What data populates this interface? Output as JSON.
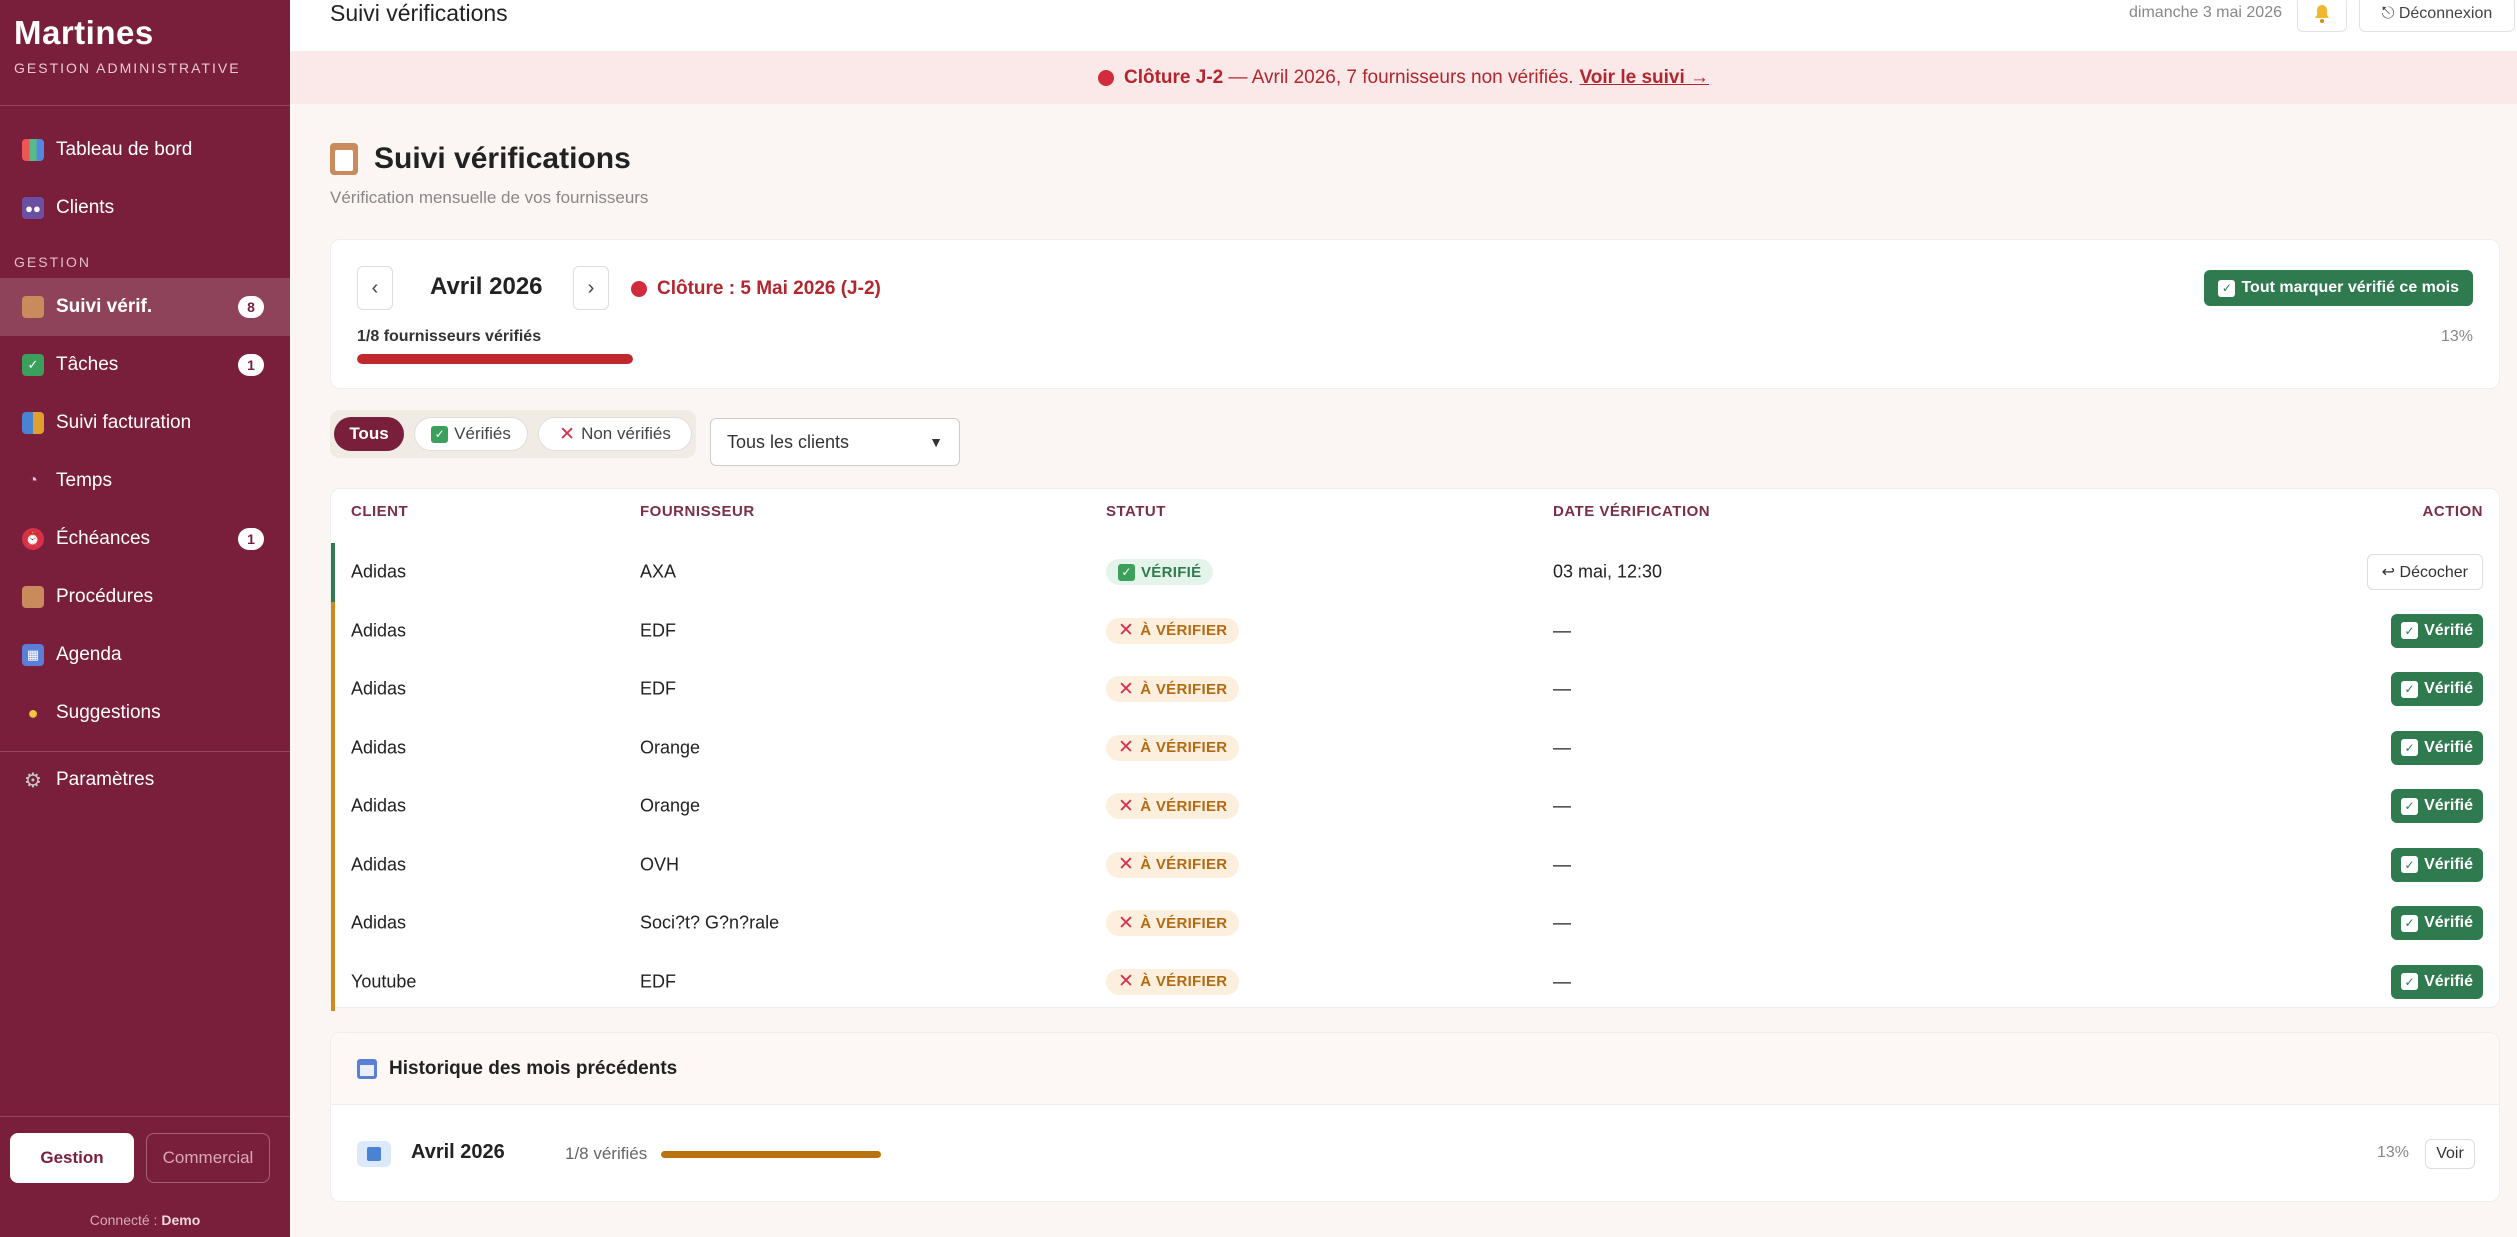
{
  "brand": {
    "name": "Martines",
    "subtitle": "GESTION ADMINISTRATIVE"
  },
  "sidebar": {
    "items": [
      {
        "label": "Tableau de bord",
        "icon": "chart-icon"
      },
      {
        "label": "Clients",
        "icon": "users-icon"
      },
      {
        "label": "Suivi vérif.",
        "icon": "clipboard-icon",
        "badge": "8",
        "active": true
      },
      {
        "label": "Tâches",
        "icon": "checkbox-icon",
        "badge": "1"
      },
      {
        "label": "Suivi facturation",
        "icon": "invoice-icon"
      },
      {
        "label": "Temps",
        "icon": "timer-icon"
      },
      {
        "label": "Échéances",
        "icon": "alarm-icon",
        "badge": "1"
      },
      {
        "label": "Procédures",
        "icon": "clipboard-icon"
      },
      {
        "label": "Agenda",
        "icon": "calendar-icon"
      },
      {
        "label": "Suggestions",
        "icon": "lightbulb-icon"
      },
      {
        "label": "Paramètres",
        "icon": "gear-icon"
      }
    ],
    "section_label": "GESTION",
    "mode_active": "Gestion",
    "mode_inactive": "Commercial",
    "connected_prefix": "Connecté :",
    "connected_user": "Demo"
  },
  "topbar": {
    "title": "Suivi vérifications",
    "date": "dimanche 3 mai 2026",
    "logout_label": "⎋ Déconnexion"
  },
  "alert": {
    "bold": "Clôture J-2",
    "text": " — Avril 2026, 7 fournisseurs non vérifiés.",
    "link": "Voir le suivi →"
  },
  "page": {
    "title": "Suivi vérifications",
    "subtitle": "Vérification mensuelle de vos fournisseurs"
  },
  "month_card": {
    "prev": "‹",
    "next": "›",
    "month": "Avril 2026",
    "cloture": "Clôture : 5 Mai 2026 (J-2)",
    "mark_all": "Tout marquer vérifié ce mois",
    "progress_label": "1/8 fournisseurs vérifiés",
    "progress_pct": "13%",
    "progress_value": 0.125
  },
  "filters": {
    "all": "Tous",
    "verified": "Vérifiés",
    "unverified": "Non vérifiés",
    "client_select": "Tous les clients"
  },
  "table": {
    "headers": {
      "client": "CLIENT",
      "supplier": "FOURNISSEUR",
      "status": "STATUT",
      "date": "DATE VÉRIFICATION",
      "action": "ACTION"
    },
    "rows": [
      {
        "client": "Adidas",
        "supplier": "AXA",
        "status": "VÉRIFIÉ",
        "date": "03 mai, 12:30",
        "action": "↩ Décocher",
        "verified": true
      },
      {
        "client": "Adidas",
        "supplier": "EDF",
        "status": "À VÉRIFIER",
        "date": "—",
        "action": "Vérifié",
        "verified": false
      },
      {
        "client": "Adidas",
        "supplier": "EDF",
        "status": "À VÉRIFIER",
        "date": "—",
        "action": "Vérifié",
        "verified": false
      },
      {
        "client": "Adidas",
        "supplier": "Orange",
        "status": "À VÉRIFIER",
        "date": "—",
        "action": "Vérifié",
        "verified": false
      },
      {
        "client": "Adidas",
        "supplier": "Orange",
        "status": "À VÉRIFIER",
        "date": "—",
        "action": "Vérifié",
        "verified": false
      },
      {
        "client": "Adidas",
        "supplier": "OVH",
        "status": "À VÉRIFIER",
        "date": "—",
        "action": "Vérifié",
        "verified": false
      },
      {
        "client": "Adidas",
        "supplier": "Soci?t? G?n?rale",
        "status": "À VÉRIFIER",
        "date": "—",
        "action": "Vérifié",
        "verified": false
      },
      {
        "client": "Youtube",
        "supplier": "EDF",
        "status": "À VÉRIFIER",
        "date": "—",
        "action": "Vérifié",
        "verified": false
      }
    ]
  },
  "history": {
    "title": "Historique des mois précédents",
    "rows": [
      {
        "month": "Avril 2026",
        "count": "1/8 vérifiés",
        "pct": "13%",
        "action": "Voir",
        "value": 0.125
      }
    ]
  },
  "colors": {
    "sidebar": "#7a1f3b",
    "green": "#2f7a4f",
    "red": "#c0282e",
    "orange": "#b8720f"
  }
}
